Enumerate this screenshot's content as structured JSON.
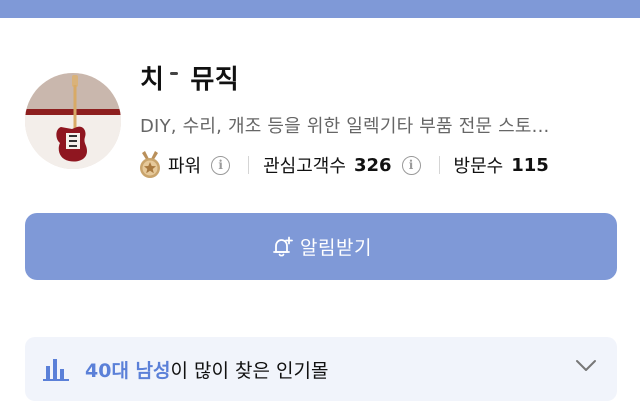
{
  "header": {
    "bar_color": "#7f99d7"
  },
  "store": {
    "name_part1": "치",
    "name_part2": "뮤직",
    "description": "DIY, 수리, 개조 등을 위한 일렉기타 부품 전문 스토...",
    "avatar_icon": "electric-guitar-avatar"
  },
  "stats": {
    "grade_label": "파워",
    "grade_icon": "medal-icon",
    "followers_label": "관심고객수",
    "followers_value": "326",
    "visits_label": "방문수",
    "visits_value": "115"
  },
  "subscribe": {
    "label": "알림받기",
    "icon": "bell-plus-icon",
    "color": "#7f99d7"
  },
  "popular": {
    "highlight": "40대 남성",
    "suffix": "이 많이 찾은 인기몰",
    "icon": "bar-chart-icon",
    "accent_color": "#5b80d8"
  }
}
